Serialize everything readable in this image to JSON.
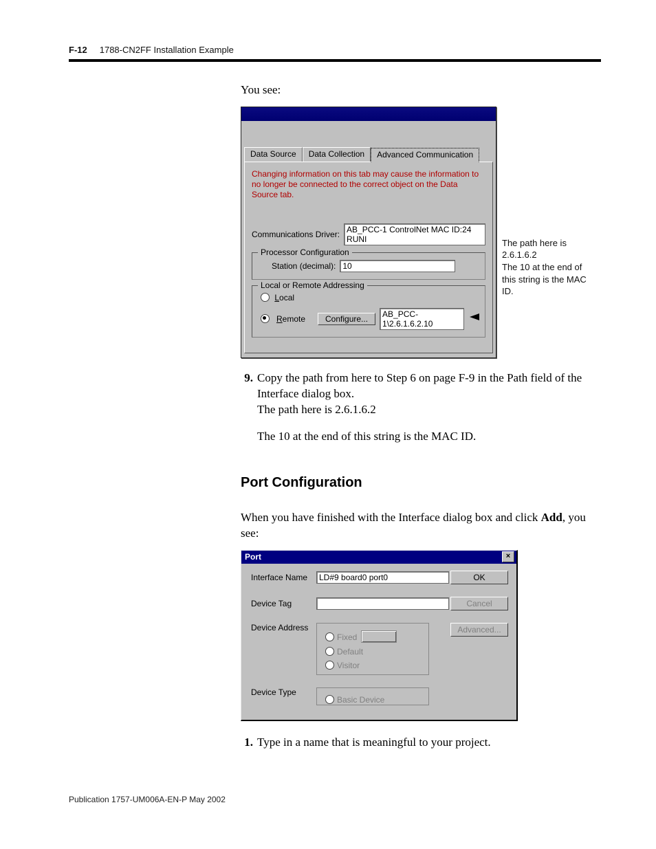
{
  "header": {
    "pgnum": "F-12",
    "title": "1788-CN2FF Installation Example"
  },
  "intro": "You see:",
  "dialog1": {
    "tabs": [
      "Data Source",
      "Data Collection",
      "Advanced Communication"
    ],
    "warn": "Changing information on this tab may cause the information to no longer be connected to the correct object on the Data Source tab.",
    "comm_driver_lbl": "Communications Driver:",
    "comm_driver_val": "AB_PCC-1  ControlNet  MAC ID:24  RUNI",
    "proc_group": "Processor Configuration",
    "station_lbl": "Station (decimal):",
    "station_val": "10",
    "addr_group": "Local or Remote Addressing",
    "local": "Local",
    "remote": "Remote",
    "configure": "Configure...",
    "remote_path": "AB_PCC-1\\2.6.1.6.2.10"
  },
  "aside": {
    "l1": "The path here is 2.6.1.6.2",
    "l2": "The 10 at the end of this string is the MAC ID."
  },
  "step9": {
    "num": "9.",
    "l1": "Copy the path from here to Step 6 on page F-9 in the Path field of the Interface dialog box.",
    "l2": "The path here is 2.6.1.6.2",
    "l3": "The 10 at the end of this string is the MAC ID."
  },
  "subhead": "Port Configuration",
  "finished_para_a": "When you have finished with the Interface dialog box and click ",
  "finished_bold": "Add",
  "finished_para_b": ", you see:",
  "dialog2": {
    "title": "Port",
    "iface_lbl": "Interface Name",
    "iface_val": "LD#9 board0 port0",
    "devtag_lbl": "Device Tag",
    "devaddr_lbl": "Device Address",
    "fixed": "Fixed",
    "default": "Default",
    "visitor": "Visitor",
    "devtype_lbl": "Device Type",
    "basicdev": "Basic Device",
    "ok": "OK",
    "cancel": "Cancel",
    "advanced": "Advanced..."
  },
  "step1": {
    "num": "1.",
    "txt": "Type in a name that is meaningful to your project."
  },
  "footer": "Publication 1757-UM006A-EN-P May 2002"
}
